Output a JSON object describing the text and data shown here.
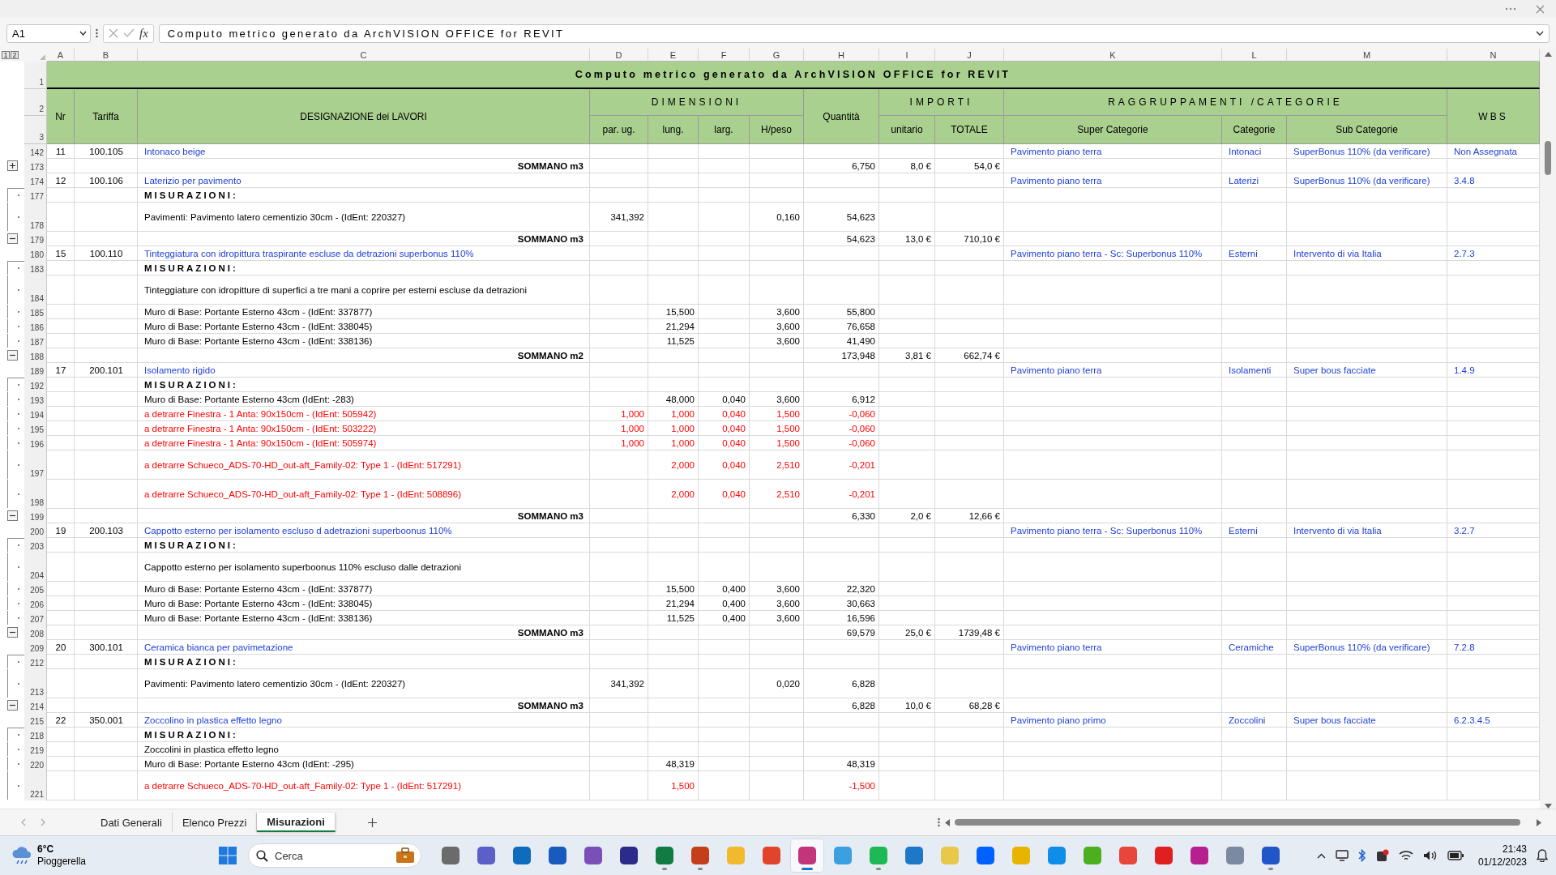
{
  "formula_bar": {
    "name_box": "A1",
    "fx_label": "fx",
    "formula": "Computo metrico generato da ArchVISION OFFICE for REVIT"
  },
  "sheet": {
    "outline_levels": [
      "1",
      "2"
    ],
    "columns": [
      "A",
      "B",
      "C",
      "D",
      "E",
      "F",
      "G",
      "H",
      "I",
      "J",
      "K",
      "L",
      "M",
      "N"
    ],
    "header": {
      "row_numbers": [
        "1",
        "2",
        "3"
      ],
      "title": "Computo metrico generato da ArchVISION OFFICE for REVIT",
      "nr": "Nr",
      "tariffa": "Tariffa",
      "designazione": "DESIGNAZIONE dei LAVORI",
      "dimensioni": "DIMENSIONI",
      "dimension_columns": [
        "par. ug.",
        "lung.",
        "larg.",
        "H/peso"
      ],
      "quantita": "Quantità",
      "importi": "IMPORTI",
      "importi_columns": [
        "unitario",
        "TOTALE"
      ],
      "raggruppamenti": "RAGGRUPPAMENTI /CATEGORIE",
      "raggruppamenti_columns": [
        "Super Categorie",
        "Categorie",
        "Sub Categorie"
      ],
      "wbs": "WBS"
    },
    "rows": [
      {
        "num": "142",
        "kind": "item",
        "cells": {
          "A": "11",
          "B": "100.105",
          "C": "Intonaco beige",
          "K": "Pavimento piano terra",
          "L": "Intonaci",
          "M": "SuperBonus 110% (da verificare)",
          "N": "Non Assegnata"
        }
      },
      {
        "num": "173",
        "kind": "sum",
        "expanded": false,
        "cells": {
          "C": "SOMMANO m3",
          "H": "6,750",
          "I": "8,0 €",
          "J": "54,0 €"
        }
      },
      {
        "num": "174",
        "kind": "item",
        "cells": {
          "A": "12",
          "B": "100.106",
          "C": "Laterizio per pavimento",
          "K": "Pavimento piano terra",
          "L": "Laterizi",
          "M": "SuperBonus 110% (da verificare)",
          "N": "3.4.8"
        }
      },
      {
        "num": "177",
        "kind": "heading",
        "in_group": true,
        "cells": {
          "C": "MISURAZIONI:"
        }
      },
      {
        "num": "178",
        "kind": "measure",
        "in_group": true,
        "tall": true,
        "cells": {
          "C": "Pavimenti: Pavimento latero cementizio 30cm - (IdEnt: 220327)",
          "D": "341,392",
          "G": "0,160",
          "H": "54,623"
        }
      },
      {
        "num": "179",
        "kind": "sum",
        "expanded": true,
        "cells": {
          "C": "SOMMANO m3",
          "H": "54,623",
          "I": "13,0 €",
          "J": "710,10 €"
        }
      },
      {
        "num": "180",
        "kind": "item",
        "cells": {
          "A": "15",
          "B": "100.110",
          "C": "Tinteggiatura con idropittura traspirante escluse da detrazioni superbonus 110%",
          "K": "Pavimento piano terra - Sc: Superbonus 110%",
          "L": "Esterni",
          "M": "Intervento di via Italia",
          "N": "2.7.3"
        }
      },
      {
        "num": "183",
        "kind": "heading",
        "in_group": true,
        "cells": {
          "C": "MISURAZIONI:"
        }
      },
      {
        "num": "184",
        "kind": "note",
        "in_group": true,
        "tall": true,
        "cells": {
          "C": "Tinteggiature con idropitture di superfici a tre mani a coprire per esterni escluse da detrazioni"
        }
      },
      {
        "num": "185",
        "kind": "measure",
        "in_group": true,
        "cells": {
          "C": "Muro di Base: Portante Esterno 43cm - (IdEnt: 337877)",
          "E": "15,500",
          "G": "3,600",
          "H": "55,800"
        }
      },
      {
        "num": "186",
        "kind": "measure",
        "in_group": true,
        "cells": {
          "C": "Muro di Base: Portante Esterno 43cm - (IdEnt: 338045)",
          "E": "21,294",
          "G": "3,600",
          "H": "76,658"
        }
      },
      {
        "num": "187",
        "kind": "measure",
        "in_group": true,
        "cells": {
          "C": "Muro di Base: Portante Esterno 43cm - (IdEnt: 338136)",
          "E": "11,525",
          "G": "3,600",
          "H": "41,490"
        }
      },
      {
        "num": "188",
        "kind": "sum",
        "expanded": true,
        "cells": {
          "C": "SOMMANO m2",
          "H": "173,948",
          "I": "3,81 €",
          "J": "662,74 €"
        }
      },
      {
        "num": "189",
        "kind": "item",
        "cells": {
          "A": "17",
          "B": "200.101",
          "C": "Isolamento rigido",
          "K": "Pavimento piano terra",
          "L": "Isolamenti",
          "M": "Super bous facciate",
          "N": "1.4.9"
        }
      },
      {
        "num": "192",
        "kind": "heading",
        "in_group": true,
        "cells": {
          "C": "MISURAZIONI:"
        }
      },
      {
        "num": "193",
        "kind": "measure",
        "in_group": true,
        "cells": {
          "C": "Muro di Base: Portante Esterno 43cm (IdEnt: -283)",
          "E": "48,000",
          "F": "0,040",
          "G": "3,600",
          "H": "6,912"
        }
      },
      {
        "num": "194",
        "kind": "deduct",
        "in_group": true,
        "cells": {
          "C": "a detrarre Finestra - 1 Anta: 90x150cm - (IdEnt: 505942)",
          "D": "1,000",
          "E": "1,000",
          "F": "0,040",
          "G": "1,500",
          "H": "-0,060"
        }
      },
      {
        "num": "195",
        "kind": "deduct",
        "in_group": true,
        "cells": {
          "C": "a detrarre Finestra - 1 Anta: 90x150cm - (IdEnt: 503222)",
          "D": "1,000",
          "E": "1,000",
          "F": "0,040",
          "G": "1,500",
          "H": "-0,060"
        }
      },
      {
        "num": "196",
        "kind": "deduct",
        "in_group": true,
        "cells": {
          "C": "a detrarre Finestra - 1 Anta: 90x150cm - (IdEnt: 505974)",
          "D": "1,000",
          "E": "1,000",
          "F": "0,040",
          "G": "1,500",
          "H": "-0,060"
        }
      },
      {
        "num": "197",
        "kind": "deduct",
        "in_group": true,
        "tall": true,
        "cells": {
          "C": "a detrarre Schueco_ADS-70-HD_out-aft_Family-02: Type 1 - (IdEnt: 517291)",
          "E": "2,000",
          "F": "0,040",
          "G": "2,510",
          "H": "-0,201"
        }
      },
      {
        "num": "198",
        "kind": "deduct",
        "in_group": true,
        "tall": true,
        "cells": {
          "C": "a detrarre Schueco_ADS-70-HD_out-aft_Family-02: Type 1 - (IdEnt: 508896)",
          "E": "2,000",
          "F": "0,040",
          "G": "2,510",
          "H": "-0,201"
        }
      },
      {
        "num": "199",
        "kind": "sum",
        "expanded": true,
        "cells": {
          "C": "SOMMANO m3",
          "H": "6,330",
          "I": "2,0 €",
          "J": "12,66 €"
        }
      },
      {
        "num": "200",
        "kind": "item",
        "cells": {
          "A": "19",
          "B": "200.103",
          "C": "Cappotto esterno per isolamento escluso d adetrazioni superboonus 110%",
          "K": "Pavimento piano terra - Sc: Superbonus 110%",
          "L": "Esterni",
          "M": "Intervento di via Italia",
          "N": "3.2.7"
        }
      },
      {
        "num": "203",
        "kind": "heading",
        "in_group": true,
        "cells": {
          "C": "MISURAZIONI:"
        }
      },
      {
        "num": "204",
        "kind": "note",
        "in_group": true,
        "tall": true,
        "cells": {
          "C": "Cappotto esterno per isolamento superboonus 110% escluso dalle detrazioni"
        }
      },
      {
        "num": "205",
        "kind": "measure",
        "in_group": true,
        "cells": {
          "C": "Muro di Base: Portante Esterno 43cm - (IdEnt: 337877)",
          "E": "15,500",
          "F": "0,400",
          "G": "3,600",
          "H": "22,320"
        }
      },
      {
        "num": "206",
        "kind": "measure",
        "in_group": true,
        "cells": {
          "C": "Muro di Base: Portante Esterno 43cm - (IdEnt: 338045)",
          "E": "21,294",
          "F": "0,400",
          "G": "3,600",
          "H": "30,663"
        }
      },
      {
        "num": "207",
        "kind": "measure",
        "in_group": true,
        "cells": {
          "C": "Muro di Base: Portante Esterno 43cm - (IdEnt: 338136)",
          "E": "11,525",
          "F": "0,400",
          "G": "3,600",
          "H": "16,596"
        }
      },
      {
        "num": "208",
        "kind": "sum",
        "expanded": true,
        "cells": {
          "C": "SOMMANO m3",
          "H": "69,579",
          "I": "25,0 €",
          "J": "1739,48 €"
        }
      },
      {
        "num": "209",
        "kind": "item",
        "cells": {
          "A": "20",
          "B": "300.101",
          "C": "Ceramica bianca per pavimetazione",
          "K": "Pavimento piano terra",
          "L": "Ceramiche",
          "M": "SuperBonus 110% (da verificare)",
          "N": "7.2.8"
        }
      },
      {
        "num": "212",
        "kind": "heading",
        "in_group": true,
        "cells": {
          "C": "MISURAZIONI:"
        }
      },
      {
        "num": "213",
        "kind": "measure",
        "in_group": true,
        "tall": true,
        "cells": {
          "C": "Pavimenti: Pavimento latero cementizio 30cm - (IdEnt: 220327)",
          "D": "341,392",
          "G": "0,020",
          "H": "6,828"
        }
      },
      {
        "num": "214",
        "kind": "sum",
        "expanded": true,
        "cells": {
          "C": "SOMMANO m3",
          "H": "6,828",
          "I": "10,0 €",
          "J": "68,28 €"
        }
      },
      {
        "num": "215",
        "kind": "item",
        "cells": {
          "A": "22",
          "B": "350.001",
          "C": "Zoccolino in plastica effetto legno",
          "K": "Pavimento piano primo",
          "L": "Zoccolini",
          "M": "Super bous facciate",
          "N": "6.2.3.4.5"
        }
      },
      {
        "num": "218",
        "kind": "heading",
        "in_group": true,
        "cells": {
          "C": "MISURAZIONI:"
        }
      },
      {
        "num": "219",
        "kind": "note",
        "in_group": true,
        "cells": {
          "C": "Zoccolini in plastica effetto legno"
        }
      },
      {
        "num": "220",
        "kind": "measure",
        "in_group": true,
        "cells": {
          "C": "Muro di Base: Portante Esterno 43cm (IdEnt: -295)",
          "E": "48,319",
          "H": "48,319"
        }
      },
      {
        "num": "221",
        "kind": "deduct",
        "in_group": true,
        "tall": true,
        "cells": {
          "C": "a detrarre Schueco_ADS-70-HD_out-aft_Family-02: Type 1 - (IdEnt: 517291)",
          "E": "1,500",
          "H": "-1,500"
        }
      }
    ]
  },
  "sheet_tabs": [
    {
      "label": "Dati Generali",
      "selected": false
    },
    {
      "label": "Elenco Prezzi",
      "selected": false
    },
    {
      "label": "Misurazioni",
      "selected": true
    }
  ],
  "taskbar": {
    "weather": {
      "temperature": "6°C",
      "condition": "Pioggerella"
    },
    "search": {
      "placeholder": "Cerca"
    },
    "apps": [
      {
        "color": "#6b6b6b",
        "running": false,
        "selected": false
      },
      {
        "color": "#5b5fc7",
        "running": false,
        "selected": false
      },
      {
        "color": "#0f6cbd",
        "running": false,
        "selected": false
      },
      {
        "color": "#185abd",
        "running": false,
        "selected": false
      },
      {
        "color": "#7b4fb8",
        "running": false,
        "selected": false
      },
      {
        "color": "#2b2b8c",
        "running": false,
        "selected": false
      },
      {
        "color": "#107c41",
        "running": true,
        "selected": false
      },
      {
        "color": "#c43e1c",
        "running": true,
        "selected": false
      },
      {
        "color": "#f2b92e",
        "running": false,
        "selected": false
      },
      {
        "color": "#e0452b",
        "running": false,
        "selected": false
      },
      {
        "color": "#c2357a",
        "running": true,
        "selected": true
      },
      {
        "color": "#3b9fe0",
        "running": false,
        "selected": false
      },
      {
        "color": "#1db954",
        "running": true,
        "selected": false
      },
      {
        "color": "#1e78c8",
        "running": false,
        "selected": false
      },
      {
        "color": "#e8c84a",
        "running": false,
        "selected": false
      },
      {
        "color": "#0061fe",
        "running": false,
        "selected": false
      },
      {
        "color": "#e8b400",
        "running": false,
        "selected": false
      },
      {
        "color": "#0e8ee9",
        "running": false,
        "selected": false
      },
      {
        "color": "#4caf1f",
        "running": false,
        "selected": false
      },
      {
        "color": "#e8453c",
        "running": false,
        "selected": false
      },
      {
        "color": "#e02020",
        "running": false,
        "selected": false
      },
      {
        "color": "#b51f8e",
        "running": false,
        "selected": false
      },
      {
        "color": "#7a8aa0",
        "running": false,
        "selected": false
      },
      {
        "color": "#2056c8",
        "running": true,
        "selected": false
      }
    ],
    "clock": {
      "time": "21:43",
      "date": "01/12/2023"
    }
  }
}
